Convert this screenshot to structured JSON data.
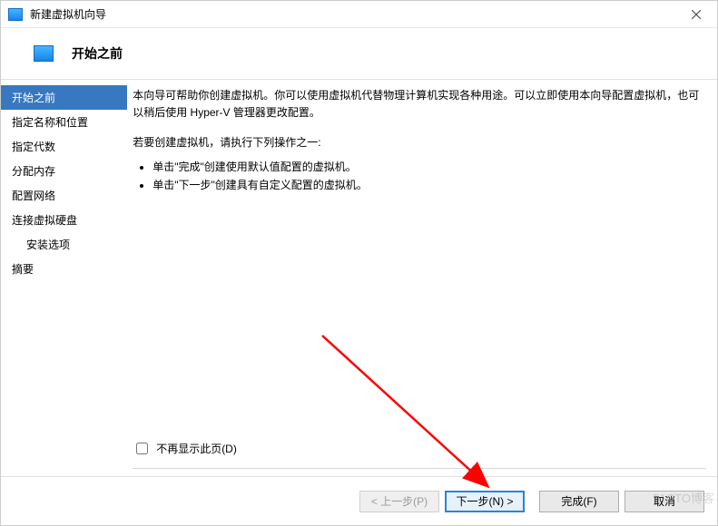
{
  "window": {
    "title": "新建虚拟机向导",
    "close_tooltip": "关闭"
  },
  "header": {
    "heading": "开始之前"
  },
  "sidebar": {
    "steps": [
      {
        "label": "开始之前",
        "selected": true
      },
      {
        "label": "指定名称和位置"
      },
      {
        "label": "指定代数"
      },
      {
        "label": "分配内存"
      },
      {
        "label": "配置网络"
      },
      {
        "label": "连接虚拟硬盘"
      },
      {
        "label": "安装选项",
        "sub": true
      },
      {
        "label": "摘要"
      }
    ]
  },
  "content": {
    "intro": "本向导可帮助你创建虚拟机。你可以使用虚拟机代替物理计算机实现各种用途。可以立即使用本向导配置虚拟机，也可以稍后使用 Hyper-V 管理器更改配置。",
    "instr": "若要创建虚拟机，请执行下列操作之一:",
    "bullets": [
      "单击\"完成\"创建使用默认值配置的虚拟机。",
      "单击\"下一步\"创建具有自定义配置的虚拟机。"
    ],
    "dont_show_label": "不再显示此页(D)"
  },
  "footer": {
    "prev": "< 上一步(P)",
    "next": "下一步(N) >",
    "finish": "完成(F)",
    "cancel": "取消"
  },
  "watermark": "51CTO博客"
}
